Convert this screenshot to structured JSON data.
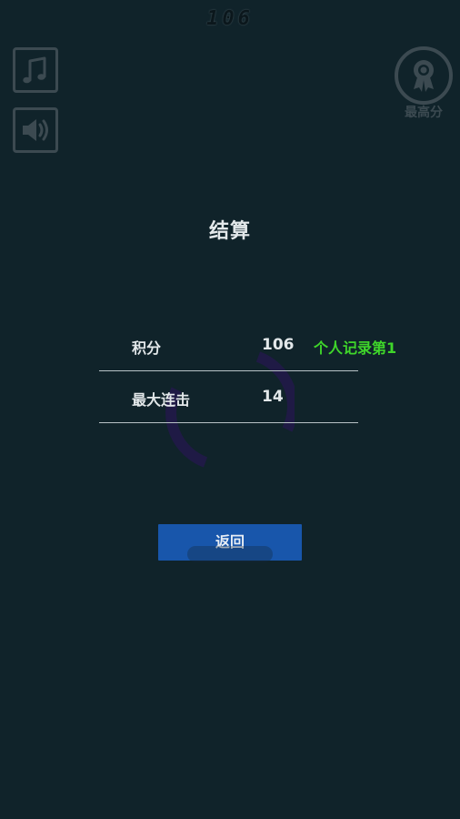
{
  "score_display": "106",
  "toolbar": {
    "music_icon": "music-note-icon",
    "sound_icon": "speaker-icon",
    "best_score_icon": "medal-icon",
    "best_score_label": "最高分"
  },
  "result": {
    "title": "结算",
    "stats": [
      {
        "label": "积分",
        "value": "106",
        "note": "个人记录第1"
      },
      {
        "label": "最大连击",
        "value": "14",
        "note": ""
      }
    ],
    "back_button_label": "返回"
  },
  "colors": {
    "background": "#10232a",
    "icon_gray": "#3c4a51",
    "record_green": "#3fd62a",
    "button_blue": "#1856ab",
    "spinner_purple": "#1f1a45"
  }
}
